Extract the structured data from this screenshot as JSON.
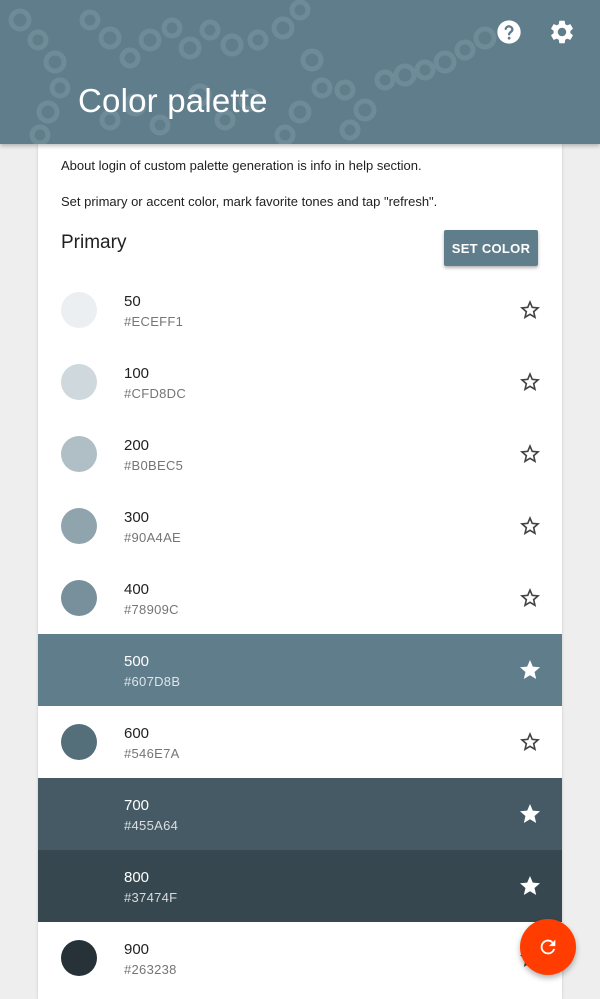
{
  "app_bar": {
    "title": "Color palette",
    "background_color": "#607D8B",
    "actions": [
      {
        "icon": "help-circle-icon"
      },
      {
        "icon": "gear-icon"
      }
    ]
  },
  "info": {
    "line1": "About login of custom palette generation is info in help section.",
    "line2": "Set primary or accent color, mark favorite tones and tap \"refresh\"."
  },
  "section": {
    "title": "Primary",
    "set_color_label": "SET COLOR"
  },
  "tones": [
    {
      "tone": "50",
      "hex": "#ECEFF1",
      "favorite": false
    },
    {
      "tone": "100",
      "hex": "#CFD8DC",
      "favorite": false
    },
    {
      "tone": "200",
      "hex": "#B0BEC5",
      "favorite": false
    },
    {
      "tone": "300",
      "hex": "#90A4AE",
      "favorite": false
    },
    {
      "tone": "400",
      "hex": "#78909C",
      "favorite": false
    },
    {
      "tone": "500",
      "hex": "#607D8B",
      "favorite": true
    },
    {
      "tone": "600",
      "hex": "#546E7A",
      "favorite": false
    },
    {
      "tone": "700",
      "hex": "#455A64",
      "favorite": true
    },
    {
      "tone": "800",
      "hex": "#37474F",
      "favorite": true
    },
    {
      "tone": "900",
      "hex": "#263238",
      "favorite": false
    }
  ],
  "fab": {
    "icon": "refresh-icon",
    "color": "#FF3D00"
  }
}
